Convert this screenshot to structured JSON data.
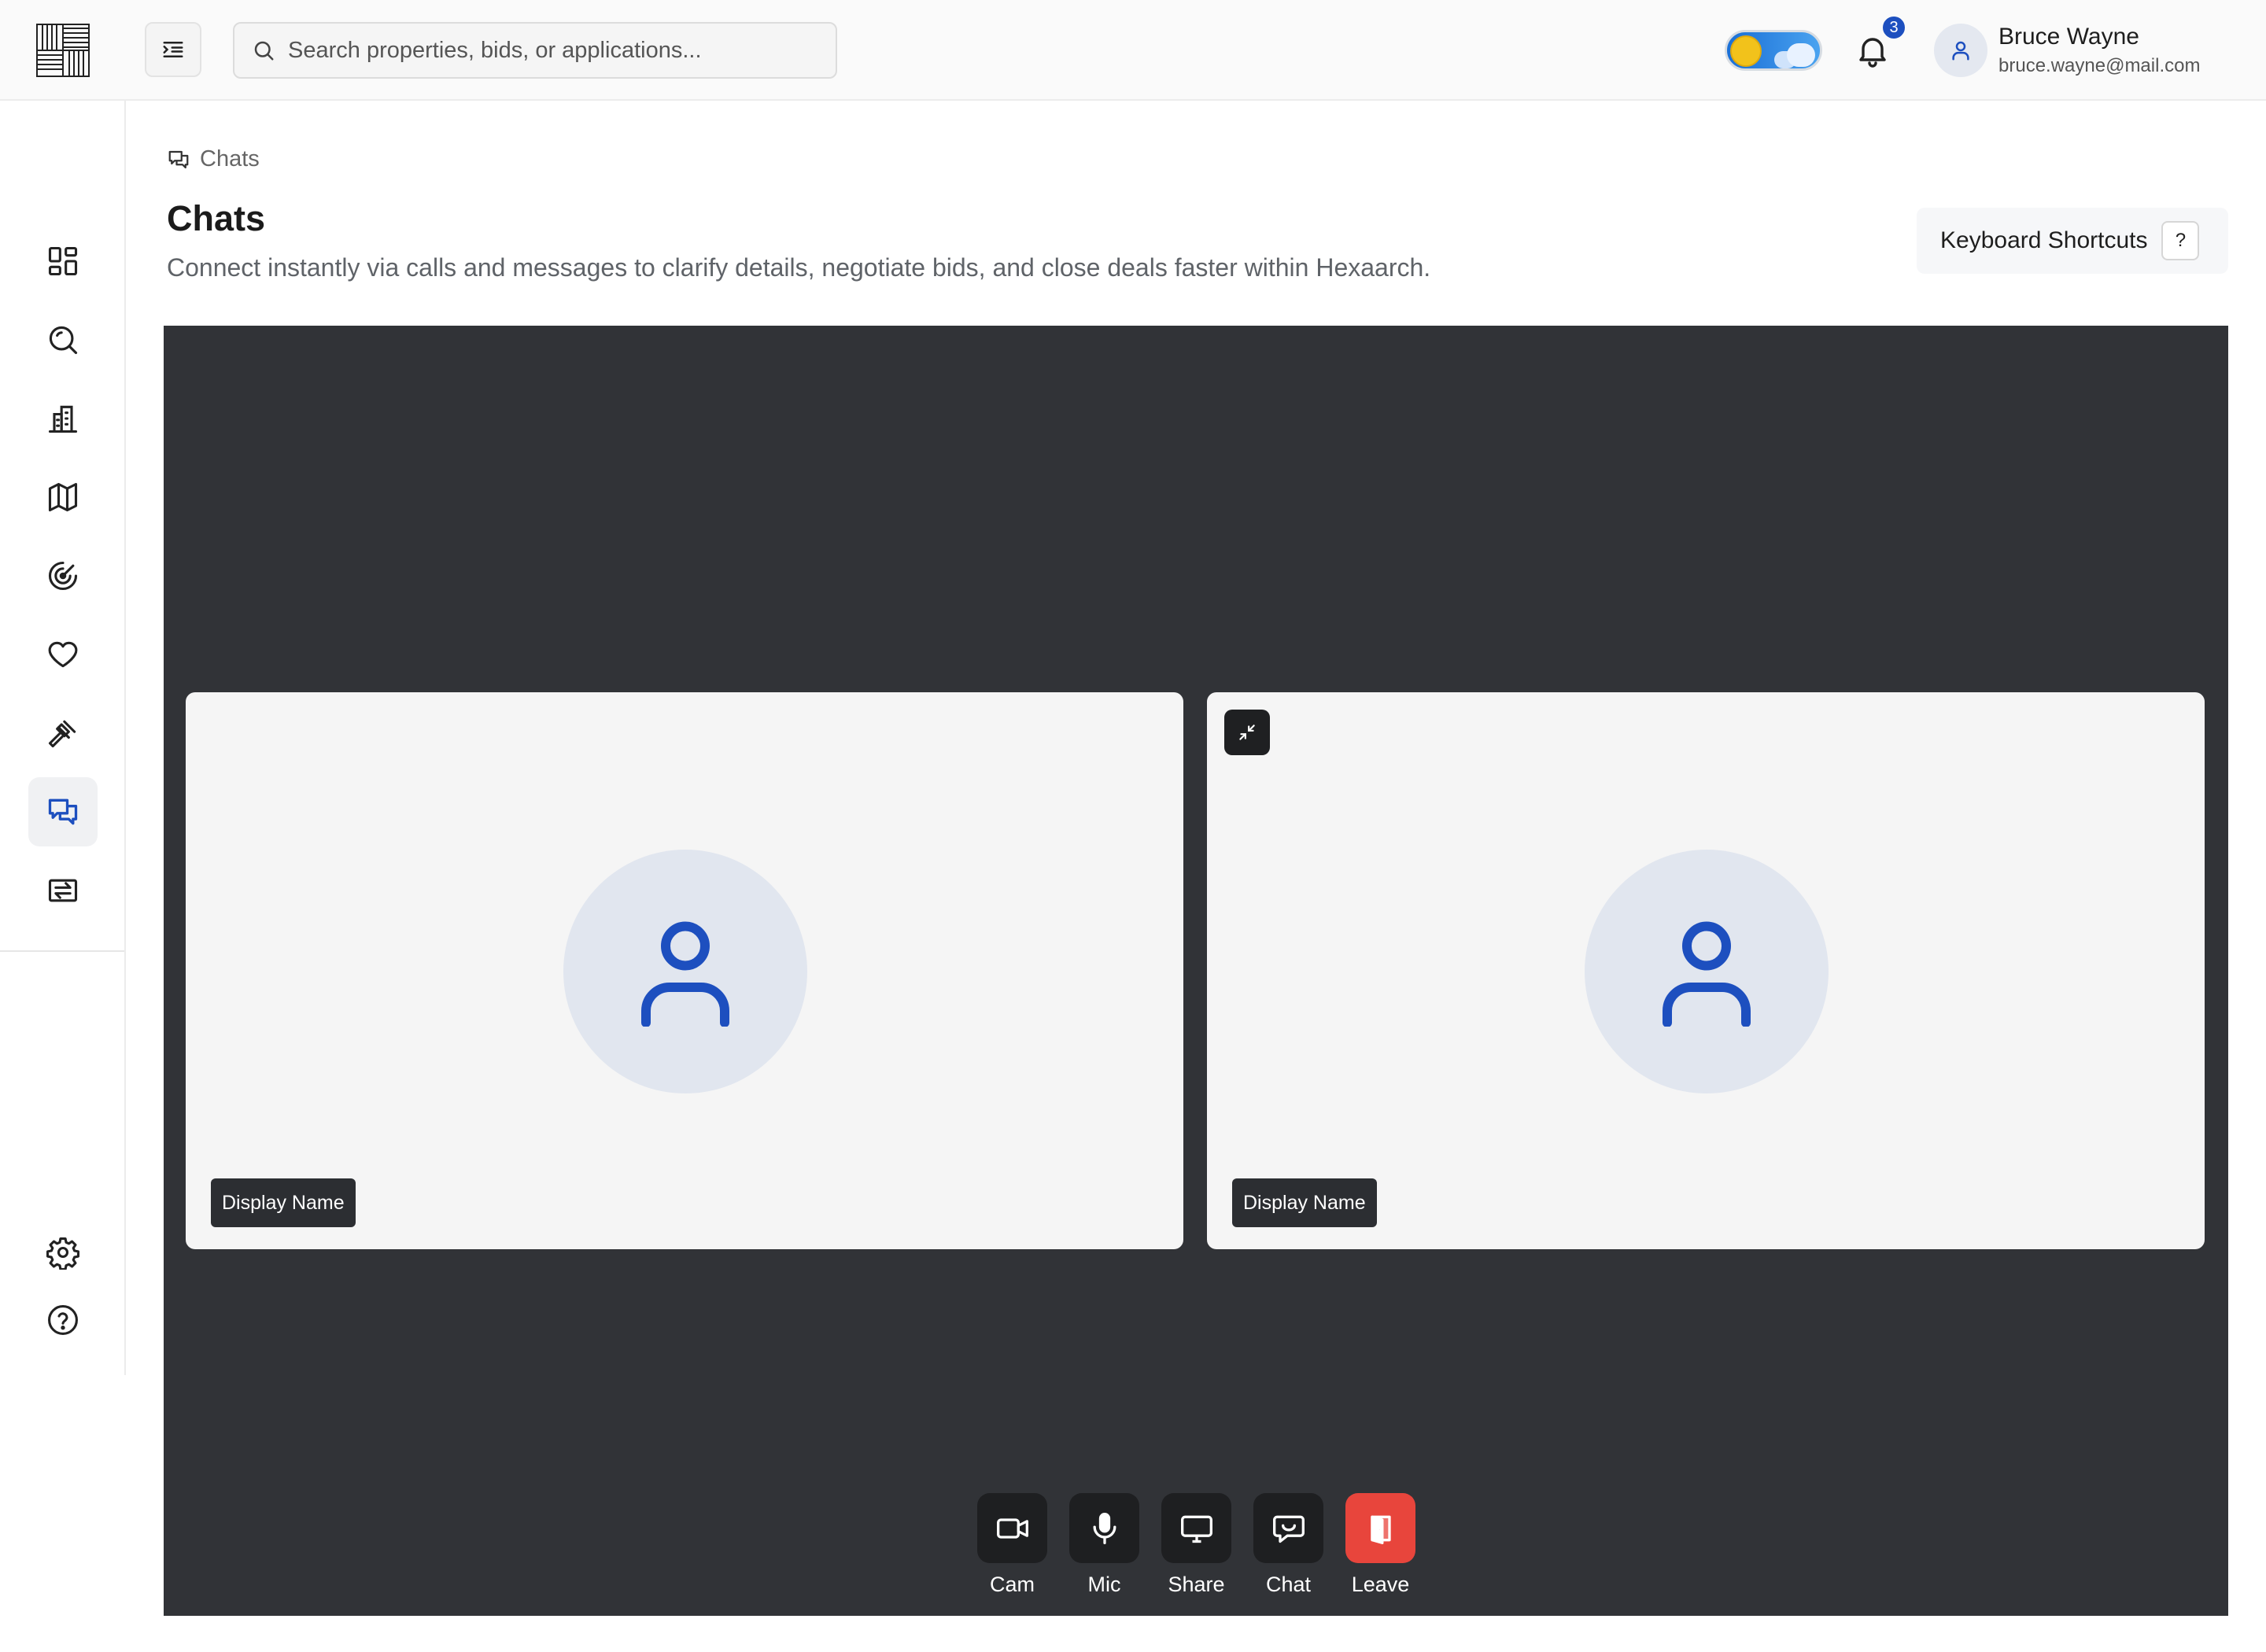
{
  "header": {
    "search_placeholder": "Search properties, bids, or applications...",
    "notification_count": "3",
    "theme_toggle": "light",
    "user": {
      "name": "Bruce Wayne",
      "email": "bruce.wayne@mail.com"
    }
  },
  "sidebar": {
    "items": [
      {
        "icon": "dashboard-icon"
      },
      {
        "icon": "search-icon"
      },
      {
        "icon": "building-icon"
      },
      {
        "icon": "map-icon"
      },
      {
        "icon": "radar-icon"
      },
      {
        "icon": "heart-icon"
      },
      {
        "icon": "gavel-icon"
      },
      {
        "icon": "chat-icon",
        "active": true
      },
      {
        "icon": "exchange-icon"
      }
    ],
    "bottom": [
      {
        "icon": "gear-icon"
      },
      {
        "icon": "help-icon"
      }
    ]
  },
  "breadcrumb": {
    "label": "Chats"
  },
  "page": {
    "title": "Chats",
    "subtitle": "Connect instantly via calls and messages to clarify details, negotiate bids, and close deals faster within Hexaarch.",
    "shortcuts_label": "Keyboard Shortcuts",
    "shortcuts_key": "?"
  },
  "call": {
    "tiles": [
      {
        "display_name": "Display Name"
      },
      {
        "display_name": "Display Name"
      }
    ],
    "controls": {
      "cam": "Cam",
      "mic": "Mic",
      "share": "Share",
      "chat": "Chat",
      "leave": "Leave"
    }
  },
  "colors": {
    "accent": "#1d4fbf",
    "stage_bg": "#313337",
    "leave": "#e8453c"
  }
}
